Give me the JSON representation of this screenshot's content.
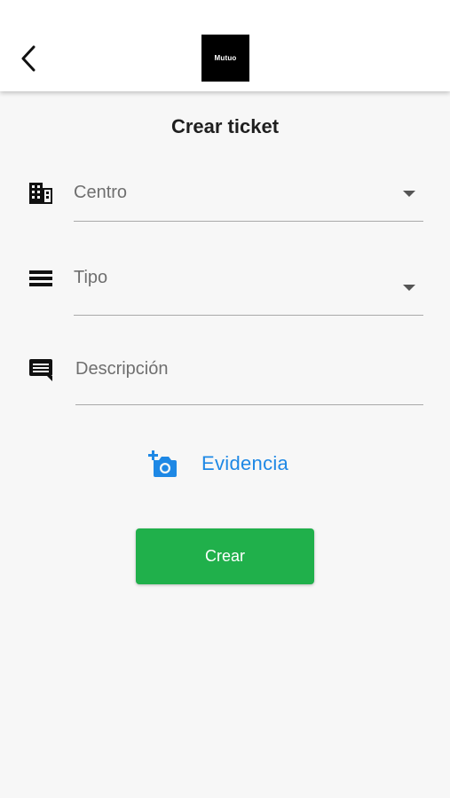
{
  "header": {
    "back_icon": "chevron-left-icon",
    "logo_text": "Mutuo"
  },
  "page": {
    "title": "Crear ticket"
  },
  "form": {
    "centro": {
      "label": "Centro",
      "icon": "building-icon"
    },
    "tipo": {
      "label": "Tipo",
      "icon": "list-lines-icon"
    },
    "descripcion": {
      "label": "Descripción",
      "icon": "comment-icon"
    },
    "evidencia": {
      "label": "Evidencia",
      "icon": "add-camera-icon"
    },
    "submit_label": "Crear"
  },
  "colors": {
    "accent_blue": "#1e88e5",
    "submit_green": "#20b04b",
    "background": "#f7f7f7"
  }
}
